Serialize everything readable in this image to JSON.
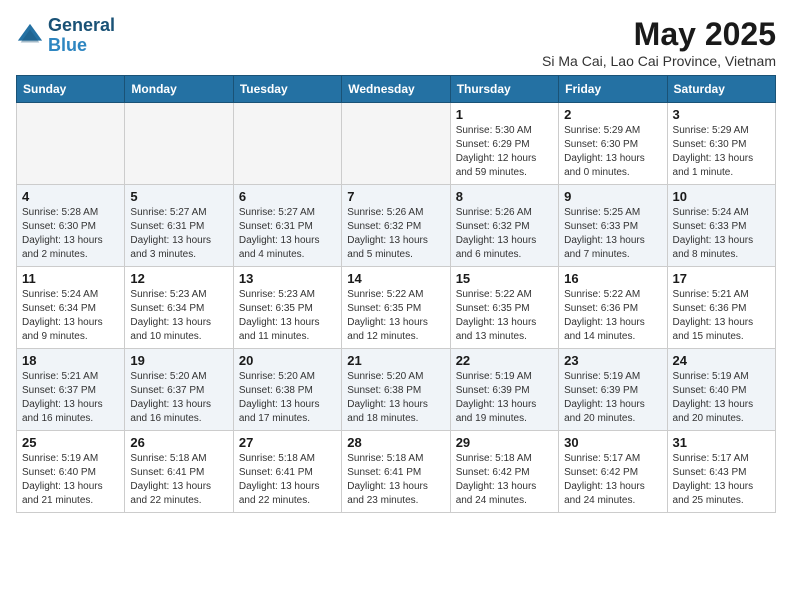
{
  "logo": {
    "line1": "General",
    "line2": "Blue"
  },
  "title": "May 2025",
  "subtitle": "Si Ma Cai, Lao Cai Province, Vietnam",
  "weekdays": [
    "Sunday",
    "Monday",
    "Tuesday",
    "Wednesday",
    "Thursday",
    "Friday",
    "Saturday"
  ],
  "weeks": [
    [
      {
        "day": "",
        "info": ""
      },
      {
        "day": "",
        "info": ""
      },
      {
        "day": "",
        "info": ""
      },
      {
        "day": "",
        "info": ""
      },
      {
        "day": "1",
        "info": "Sunrise: 5:30 AM\nSunset: 6:29 PM\nDaylight: 12 hours\nand 59 minutes."
      },
      {
        "day": "2",
        "info": "Sunrise: 5:29 AM\nSunset: 6:30 PM\nDaylight: 13 hours\nand 0 minutes."
      },
      {
        "day": "3",
        "info": "Sunrise: 5:29 AM\nSunset: 6:30 PM\nDaylight: 13 hours\nand 1 minute."
      }
    ],
    [
      {
        "day": "4",
        "info": "Sunrise: 5:28 AM\nSunset: 6:30 PM\nDaylight: 13 hours\nand 2 minutes."
      },
      {
        "day": "5",
        "info": "Sunrise: 5:27 AM\nSunset: 6:31 PM\nDaylight: 13 hours\nand 3 minutes."
      },
      {
        "day": "6",
        "info": "Sunrise: 5:27 AM\nSunset: 6:31 PM\nDaylight: 13 hours\nand 4 minutes."
      },
      {
        "day": "7",
        "info": "Sunrise: 5:26 AM\nSunset: 6:32 PM\nDaylight: 13 hours\nand 5 minutes."
      },
      {
        "day": "8",
        "info": "Sunrise: 5:26 AM\nSunset: 6:32 PM\nDaylight: 13 hours\nand 6 minutes."
      },
      {
        "day": "9",
        "info": "Sunrise: 5:25 AM\nSunset: 6:33 PM\nDaylight: 13 hours\nand 7 minutes."
      },
      {
        "day": "10",
        "info": "Sunrise: 5:24 AM\nSunset: 6:33 PM\nDaylight: 13 hours\nand 8 minutes."
      }
    ],
    [
      {
        "day": "11",
        "info": "Sunrise: 5:24 AM\nSunset: 6:34 PM\nDaylight: 13 hours\nand 9 minutes."
      },
      {
        "day": "12",
        "info": "Sunrise: 5:23 AM\nSunset: 6:34 PM\nDaylight: 13 hours\nand 10 minutes."
      },
      {
        "day": "13",
        "info": "Sunrise: 5:23 AM\nSunset: 6:35 PM\nDaylight: 13 hours\nand 11 minutes."
      },
      {
        "day": "14",
        "info": "Sunrise: 5:22 AM\nSunset: 6:35 PM\nDaylight: 13 hours\nand 12 minutes."
      },
      {
        "day": "15",
        "info": "Sunrise: 5:22 AM\nSunset: 6:35 PM\nDaylight: 13 hours\nand 13 minutes."
      },
      {
        "day": "16",
        "info": "Sunrise: 5:22 AM\nSunset: 6:36 PM\nDaylight: 13 hours\nand 14 minutes."
      },
      {
        "day": "17",
        "info": "Sunrise: 5:21 AM\nSunset: 6:36 PM\nDaylight: 13 hours\nand 15 minutes."
      }
    ],
    [
      {
        "day": "18",
        "info": "Sunrise: 5:21 AM\nSunset: 6:37 PM\nDaylight: 13 hours\nand 16 minutes."
      },
      {
        "day": "19",
        "info": "Sunrise: 5:20 AM\nSunset: 6:37 PM\nDaylight: 13 hours\nand 16 minutes."
      },
      {
        "day": "20",
        "info": "Sunrise: 5:20 AM\nSunset: 6:38 PM\nDaylight: 13 hours\nand 17 minutes."
      },
      {
        "day": "21",
        "info": "Sunrise: 5:20 AM\nSunset: 6:38 PM\nDaylight: 13 hours\nand 18 minutes."
      },
      {
        "day": "22",
        "info": "Sunrise: 5:19 AM\nSunset: 6:39 PM\nDaylight: 13 hours\nand 19 minutes."
      },
      {
        "day": "23",
        "info": "Sunrise: 5:19 AM\nSunset: 6:39 PM\nDaylight: 13 hours\nand 20 minutes."
      },
      {
        "day": "24",
        "info": "Sunrise: 5:19 AM\nSunset: 6:40 PM\nDaylight: 13 hours\nand 20 minutes."
      }
    ],
    [
      {
        "day": "25",
        "info": "Sunrise: 5:19 AM\nSunset: 6:40 PM\nDaylight: 13 hours\nand 21 minutes."
      },
      {
        "day": "26",
        "info": "Sunrise: 5:18 AM\nSunset: 6:41 PM\nDaylight: 13 hours\nand 22 minutes."
      },
      {
        "day": "27",
        "info": "Sunrise: 5:18 AM\nSunset: 6:41 PM\nDaylight: 13 hours\nand 22 minutes."
      },
      {
        "day": "28",
        "info": "Sunrise: 5:18 AM\nSunset: 6:41 PM\nDaylight: 13 hours\nand 23 minutes."
      },
      {
        "day": "29",
        "info": "Sunrise: 5:18 AM\nSunset: 6:42 PM\nDaylight: 13 hours\nand 24 minutes."
      },
      {
        "day": "30",
        "info": "Sunrise: 5:17 AM\nSunset: 6:42 PM\nDaylight: 13 hours\nand 24 minutes."
      },
      {
        "day": "31",
        "info": "Sunrise: 5:17 AM\nSunset: 6:43 PM\nDaylight: 13 hours\nand 25 minutes."
      }
    ]
  ]
}
